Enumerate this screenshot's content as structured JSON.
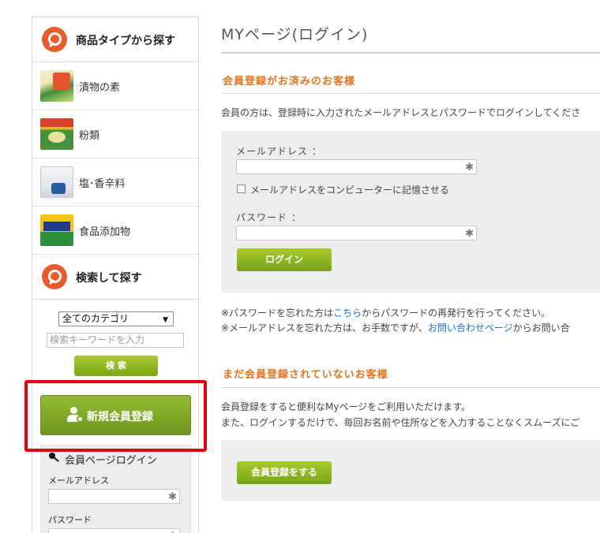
{
  "sidebar": {
    "product_type_heading": "商品タイプから探す",
    "categories": [
      {
        "label": "漬物の素"
      },
      {
        "label": "粉類"
      },
      {
        "label": "塩･香辛料"
      },
      {
        "label": "食品添加物"
      }
    ],
    "search_heading": "検索して探す",
    "category_select": "全てのカテゴリ",
    "keyword_placeholder": "検索キーワードを入力",
    "search_button": "検 索",
    "register_button": "新規会員登録",
    "login": {
      "heading": "会員ページログイン",
      "email_label": "メールアドレス",
      "password_label": "パスワード"
    }
  },
  "main": {
    "title": "MYページ(ログイン)",
    "members_heading": "会員登録がお済みのお客様",
    "members_text": "会員の方は、登録時に入力されたメールアドレスとパスワードでログインしてくださ",
    "form": {
      "email_label": "メールアドレス ：",
      "remember_label": "メールアドレスをコンピューターに記憶させる",
      "password_label": "パスワード ：",
      "login_button": "ログイン"
    },
    "note1_prefix": "※パスワードを忘れた方は",
    "note1_link": "こちら",
    "note1_suffix": "からパスワードの再発行を行ってください。",
    "note2_prefix": "※メールアドレスを忘れた方は、お手数ですが、",
    "note2_link": "お問い合わせページ",
    "note2_suffix": "からお問い合",
    "nonmembers_heading": "まだ会員登録されていないお客様",
    "nonmembers_text1": "会員登録をすると便利なMyページをご利用いただけます。",
    "nonmembers_text2": "また、ログインするだけで、毎回お名前や住所などを入力することなくスムーズにご",
    "register_button": "会員登録をする"
  },
  "colors": {
    "accent_orange": "#e8731b",
    "button_green": "#8fb827",
    "highlight_red": "#e60012",
    "link_blue": "#1e6fc2"
  }
}
